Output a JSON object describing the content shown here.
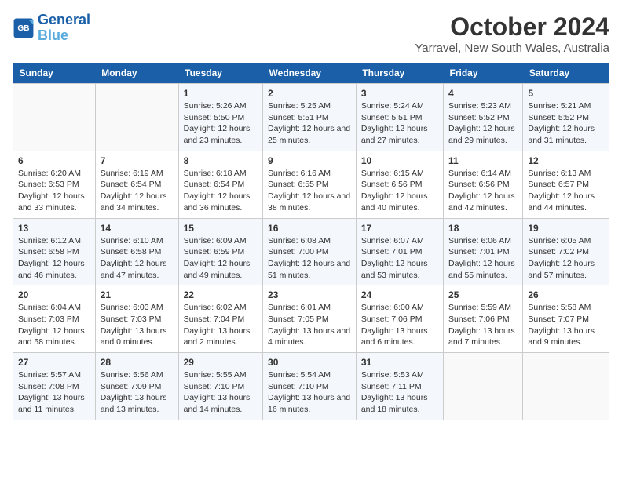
{
  "header": {
    "logo_line1": "General",
    "logo_line2": "Blue",
    "month_title": "October 2024",
    "subtitle": "Yarravel, New South Wales, Australia"
  },
  "days_of_week": [
    "Sunday",
    "Monday",
    "Tuesday",
    "Wednesday",
    "Thursday",
    "Friday",
    "Saturday"
  ],
  "weeks": [
    [
      {
        "day": "",
        "sunrise": "",
        "sunset": "",
        "daylight": ""
      },
      {
        "day": "",
        "sunrise": "",
        "sunset": "",
        "daylight": ""
      },
      {
        "day": "1",
        "sunrise": "Sunrise: 5:26 AM",
        "sunset": "Sunset: 5:50 PM",
        "daylight": "Daylight: 12 hours and 23 minutes."
      },
      {
        "day": "2",
        "sunrise": "Sunrise: 5:25 AM",
        "sunset": "Sunset: 5:51 PM",
        "daylight": "Daylight: 12 hours and 25 minutes."
      },
      {
        "day": "3",
        "sunrise": "Sunrise: 5:24 AM",
        "sunset": "Sunset: 5:51 PM",
        "daylight": "Daylight: 12 hours and 27 minutes."
      },
      {
        "day": "4",
        "sunrise": "Sunrise: 5:23 AM",
        "sunset": "Sunset: 5:52 PM",
        "daylight": "Daylight: 12 hours and 29 minutes."
      },
      {
        "day": "5",
        "sunrise": "Sunrise: 5:21 AM",
        "sunset": "Sunset: 5:52 PM",
        "daylight": "Daylight: 12 hours and 31 minutes."
      }
    ],
    [
      {
        "day": "6",
        "sunrise": "Sunrise: 6:20 AM",
        "sunset": "Sunset: 6:53 PM",
        "daylight": "Daylight: 12 hours and 33 minutes."
      },
      {
        "day": "7",
        "sunrise": "Sunrise: 6:19 AM",
        "sunset": "Sunset: 6:54 PM",
        "daylight": "Daylight: 12 hours and 34 minutes."
      },
      {
        "day": "8",
        "sunrise": "Sunrise: 6:18 AM",
        "sunset": "Sunset: 6:54 PM",
        "daylight": "Daylight: 12 hours and 36 minutes."
      },
      {
        "day": "9",
        "sunrise": "Sunrise: 6:16 AM",
        "sunset": "Sunset: 6:55 PM",
        "daylight": "Daylight: 12 hours and 38 minutes."
      },
      {
        "day": "10",
        "sunrise": "Sunrise: 6:15 AM",
        "sunset": "Sunset: 6:56 PM",
        "daylight": "Daylight: 12 hours and 40 minutes."
      },
      {
        "day": "11",
        "sunrise": "Sunrise: 6:14 AM",
        "sunset": "Sunset: 6:56 PM",
        "daylight": "Daylight: 12 hours and 42 minutes."
      },
      {
        "day": "12",
        "sunrise": "Sunrise: 6:13 AM",
        "sunset": "Sunset: 6:57 PM",
        "daylight": "Daylight: 12 hours and 44 minutes."
      }
    ],
    [
      {
        "day": "13",
        "sunrise": "Sunrise: 6:12 AM",
        "sunset": "Sunset: 6:58 PM",
        "daylight": "Daylight: 12 hours and 46 minutes."
      },
      {
        "day": "14",
        "sunrise": "Sunrise: 6:10 AM",
        "sunset": "Sunset: 6:58 PM",
        "daylight": "Daylight: 12 hours and 47 minutes."
      },
      {
        "day": "15",
        "sunrise": "Sunrise: 6:09 AM",
        "sunset": "Sunset: 6:59 PM",
        "daylight": "Daylight: 12 hours and 49 minutes."
      },
      {
        "day": "16",
        "sunrise": "Sunrise: 6:08 AM",
        "sunset": "Sunset: 7:00 PM",
        "daylight": "Daylight: 12 hours and 51 minutes."
      },
      {
        "day": "17",
        "sunrise": "Sunrise: 6:07 AM",
        "sunset": "Sunset: 7:01 PM",
        "daylight": "Daylight: 12 hours and 53 minutes."
      },
      {
        "day": "18",
        "sunrise": "Sunrise: 6:06 AM",
        "sunset": "Sunset: 7:01 PM",
        "daylight": "Daylight: 12 hours and 55 minutes."
      },
      {
        "day": "19",
        "sunrise": "Sunrise: 6:05 AM",
        "sunset": "Sunset: 7:02 PM",
        "daylight": "Daylight: 12 hours and 57 minutes."
      }
    ],
    [
      {
        "day": "20",
        "sunrise": "Sunrise: 6:04 AM",
        "sunset": "Sunset: 7:03 PM",
        "daylight": "Daylight: 12 hours and 58 minutes."
      },
      {
        "day": "21",
        "sunrise": "Sunrise: 6:03 AM",
        "sunset": "Sunset: 7:03 PM",
        "daylight": "Daylight: 13 hours and 0 minutes."
      },
      {
        "day": "22",
        "sunrise": "Sunrise: 6:02 AM",
        "sunset": "Sunset: 7:04 PM",
        "daylight": "Daylight: 13 hours and 2 minutes."
      },
      {
        "day": "23",
        "sunrise": "Sunrise: 6:01 AM",
        "sunset": "Sunset: 7:05 PM",
        "daylight": "Daylight: 13 hours and 4 minutes."
      },
      {
        "day": "24",
        "sunrise": "Sunrise: 6:00 AM",
        "sunset": "Sunset: 7:06 PM",
        "daylight": "Daylight: 13 hours and 6 minutes."
      },
      {
        "day": "25",
        "sunrise": "Sunrise: 5:59 AM",
        "sunset": "Sunset: 7:06 PM",
        "daylight": "Daylight: 13 hours and 7 minutes."
      },
      {
        "day": "26",
        "sunrise": "Sunrise: 5:58 AM",
        "sunset": "Sunset: 7:07 PM",
        "daylight": "Daylight: 13 hours and 9 minutes."
      }
    ],
    [
      {
        "day": "27",
        "sunrise": "Sunrise: 5:57 AM",
        "sunset": "Sunset: 7:08 PM",
        "daylight": "Daylight: 13 hours and 11 minutes."
      },
      {
        "day": "28",
        "sunrise": "Sunrise: 5:56 AM",
        "sunset": "Sunset: 7:09 PM",
        "daylight": "Daylight: 13 hours and 13 minutes."
      },
      {
        "day": "29",
        "sunrise": "Sunrise: 5:55 AM",
        "sunset": "Sunset: 7:10 PM",
        "daylight": "Daylight: 13 hours and 14 minutes."
      },
      {
        "day": "30",
        "sunrise": "Sunrise: 5:54 AM",
        "sunset": "Sunset: 7:10 PM",
        "daylight": "Daylight: 13 hours and 16 minutes."
      },
      {
        "day": "31",
        "sunrise": "Sunrise: 5:53 AM",
        "sunset": "Sunset: 7:11 PM",
        "daylight": "Daylight: 13 hours and 18 minutes."
      },
      {
        "day": "",
        "sunrise": "",
        "sunset": "",
        "daylight": ""
      },
      {
        "day": "",
        "sunrise": "",
        "sunset": "",
        "daylight": ""
      }
    ]
  ]
}
